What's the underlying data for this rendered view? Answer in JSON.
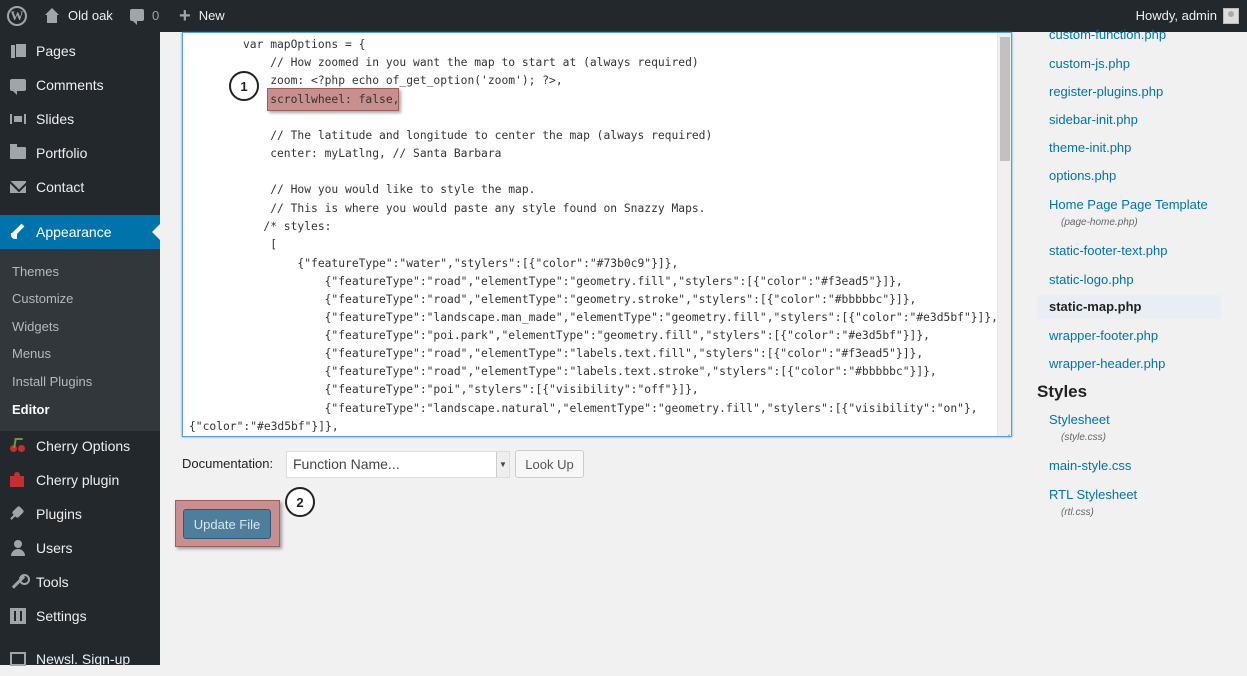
{
  "adminbar": {
    "site_name": "Old oak",
    "comments_count": "0",
    "new_label": "New",
    "howdy": "Howdy, admin"
  },
  "sidebar": {
    "items": [
      {
        "label": "Pages",
        "icon": "pages-icon"
      },
      {
        "label": "Comments",
        "icon": "comments-icon"
      },
      {
        "label": "Slides",
        "icon": "slides-icon"
      },
      {
        "label": "Portfolio",
        "icon": "portfolio-icon"
      },
      {
        "label": "Contact",
        "icon": "mail-icon"
      },
      {
        "label": "Appearance",
        "icon": "paintbrush-icon"
      },
      {
        "label": "Cherry Options",
        "icon": "cherry-icon"
      },
      {
        "label": "Cherry plugin",
        "icon": "puzzle-icon"
      },
      {
        "label": "Plugins",
        "icon": "plugin-icon"
      },
      {
        "label": "Users",
        "icon": "users-icon"
      },
      {
        "label": "Tools",
        "icon": "tools-icon"
      },
      {
        "label": "Settings",
        "icon": "settings-icon"
      },
      {
        "label": "Newsl. Sign-up",
        "icon": "newsletter-icon"
      }
    ],
    "submenu": [
      "Themes",
      "Customize",
      "Widgets",
      "Menus",
      "Install Plugins",
      "Editor"
    ]
  },
  "editor": {
    "lines": [
      "var mapOptions = {",
      "    // How zoomed in you want the map to start at (always required)",
      "    zoom: <?php echo of_get_option('zoom'); ?>,",
      "    scrollwheel: false,",
      "",
      "    // The latitude and longitude to center the map (always required)",
      "    center: myLatlng, // Santa Barbara",
      "",
      "    // How you would like to style the map.",
      "    // This is where you would paste any style found on Snazzy Maps.",
      "   /* styles:",
      "    [",
      "        {\"featureType\":\"water\",\"stylers\":[{\"color\":\"#73b0c9\"}]},",
      "            {\"featureType\":\"road\",\"elementType\":\"geometry.fill\",\"stylers\":[{\"color\":\"#f3ead5\"}]},",
      "            {\"featureType\":\"road\",\"elementType\":\"geometry.stroke\",\"stylers\":[{\"color\":\"#bbbbbc\"}]},",
      "            {\"featureType\":\"landscape.man_made\",\"elementType\":\"geometry.fill\",\"stylers\":[{\"color\":\"#e3d5bf\"}]},",
      "            {\"featureType\":\"poi.park\",\"elementType\":\"geometry.fill\",\"stylers\":[{\"color\":\"#e3d5bf\"}]},",
      "            {\"featureType\":\"road\",\"elementType\":\"labels.text.fill\",\"stylers\":[{\"color\":\"#f3ead5\"}]},",
      "            {\"featureType\":\"road\",\"elementType\":\"labels.text.stroke\",\"stylers\":[{\"color\":\"#bbbbbc\"}]},",
      "            {\"featureType\":\"poi\",\"stylers\":[{\"visibility\":\"off\"}]},",
      "            {\"featureType\":\"landscape.natural\",\"elementType\":\"geometry.fill\",\"stylers\":[{\"visibility\":\"on\"},",
      "{\"color\":\"#e3d5bf\"}]},"
    ]
  },
  "badges": {
    "one": "1",
    "two": "2"
  },
  "documentation": {
    "label": "Documentation:",
    "select_value": "Function Name...",
    "lookup_label": "Look Up"
  },
  "update_label": "Update File",
  "files": {
    "templates": [
      {
        "name": "custom-function.php"
      },
      {
        "name": "custom-js.php"
      },
      {
        "name": "register-plugins.php"
      },
      {
        "name": "sidebar-init.php"
      },
      {
        "name": "theme-init.php"
      },
      {
        "name": "options.php"
      },
      {
        "name": "Home Page Page Template",
        "sub": "(page-home.php)"
      },
      {
        "name": "static-footer-text.php"
      },
      {
        "name": "static-logo.php"
      },
      {
        "name": "static-map.php"
      },
      {
        "name": "wrapper-footer.php"
      },
      {
        "name": "wrapper-header.php"
      }
    ],
    "styles_heading": "Styles",
    "styles": [
      {
        "name": "Stylesheet",
        "sub": "(style.css)"
      },
      {
        "name": "main-style.css"
      },
      {
        "name": "RTL Stylesheet",
        "sub": "(rtl.css)"
      }
    ]
  },
  "colors": {
    "admin_dark": "#23282d",
    "accent": "#0073aa",
    "highlight": "#c98f8f",
    "link": "#0073aa"
  }
}
